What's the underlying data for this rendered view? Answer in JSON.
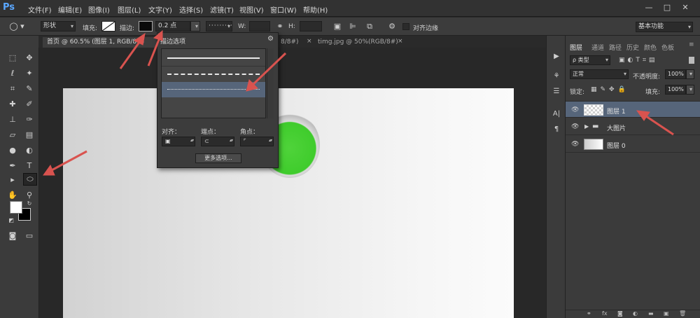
{
  "app": {
    "logo": "Ps"
  },
  "menus": [
    "文件(F)",
    "编辑(E)",
    "图像(I)",
    "图层(L)",
    "文字(Y)",
    "选择(S)",
    "滤镜(T)",
    "视图(V)",
    "窗口(W)",
    "帮助(H)"
  ],
  "window_controls": [
    "—",
    "□",
    "✕"
  ],
  "options_bar": {
    "mode": "形状",
    "fill_label": "填充:",
    "stroke_label": "描边:",
    "stroke_width": "0.2 点",
    "w_label": "W:",
    "h_label": "H:",
    "align_edges": "对齐边缘",
    "workspace": "基本功能"
  },
  "doc_tabs": [
    "首页 @ 60.5% (图层 1, RGB/8#)",
    "8/8#)",
    "timg.jpg @ 50%(RGB/8#)"
  ],
  "stroke_popup": {
    "title": "描边选项",
    "options": [
      "solid",
      "dashed",
      "dotted"
    ],
    "selected_index": 2,
    "align_label": "对齐：",
    "cap_label": "端点：",
    "corner_label": "角点：",
    "more_button": "更多选项..."
  },
  "layers_panel": {
    "tabs": [
      "图层",
      "通道",
      "路径",
      "历史",
      "颜色",
      "色板"
    ],
    "filter_kind": "ρ 类型",
    "blend_mode": "正常",
    "opacity_label": "不透明度:",
    "opacity": "100%",
    "lock_label": "锁定:",
    "fill_label": "填充:",
    "fill": "100%",
    "layers": [
      {
        "name": "图层 1",
        "selected": true
      },
      {
        "name": "大图片",
        "selected": false
      },
      {
        "name": "图层 0",
        "selected": false
      }
    ]
  },
  "colors": {
    "accent_selection": "#56657a",
    "annotation_arrow": "#d9534f",
    "circle_green": "#4fd33a"
  }
}
